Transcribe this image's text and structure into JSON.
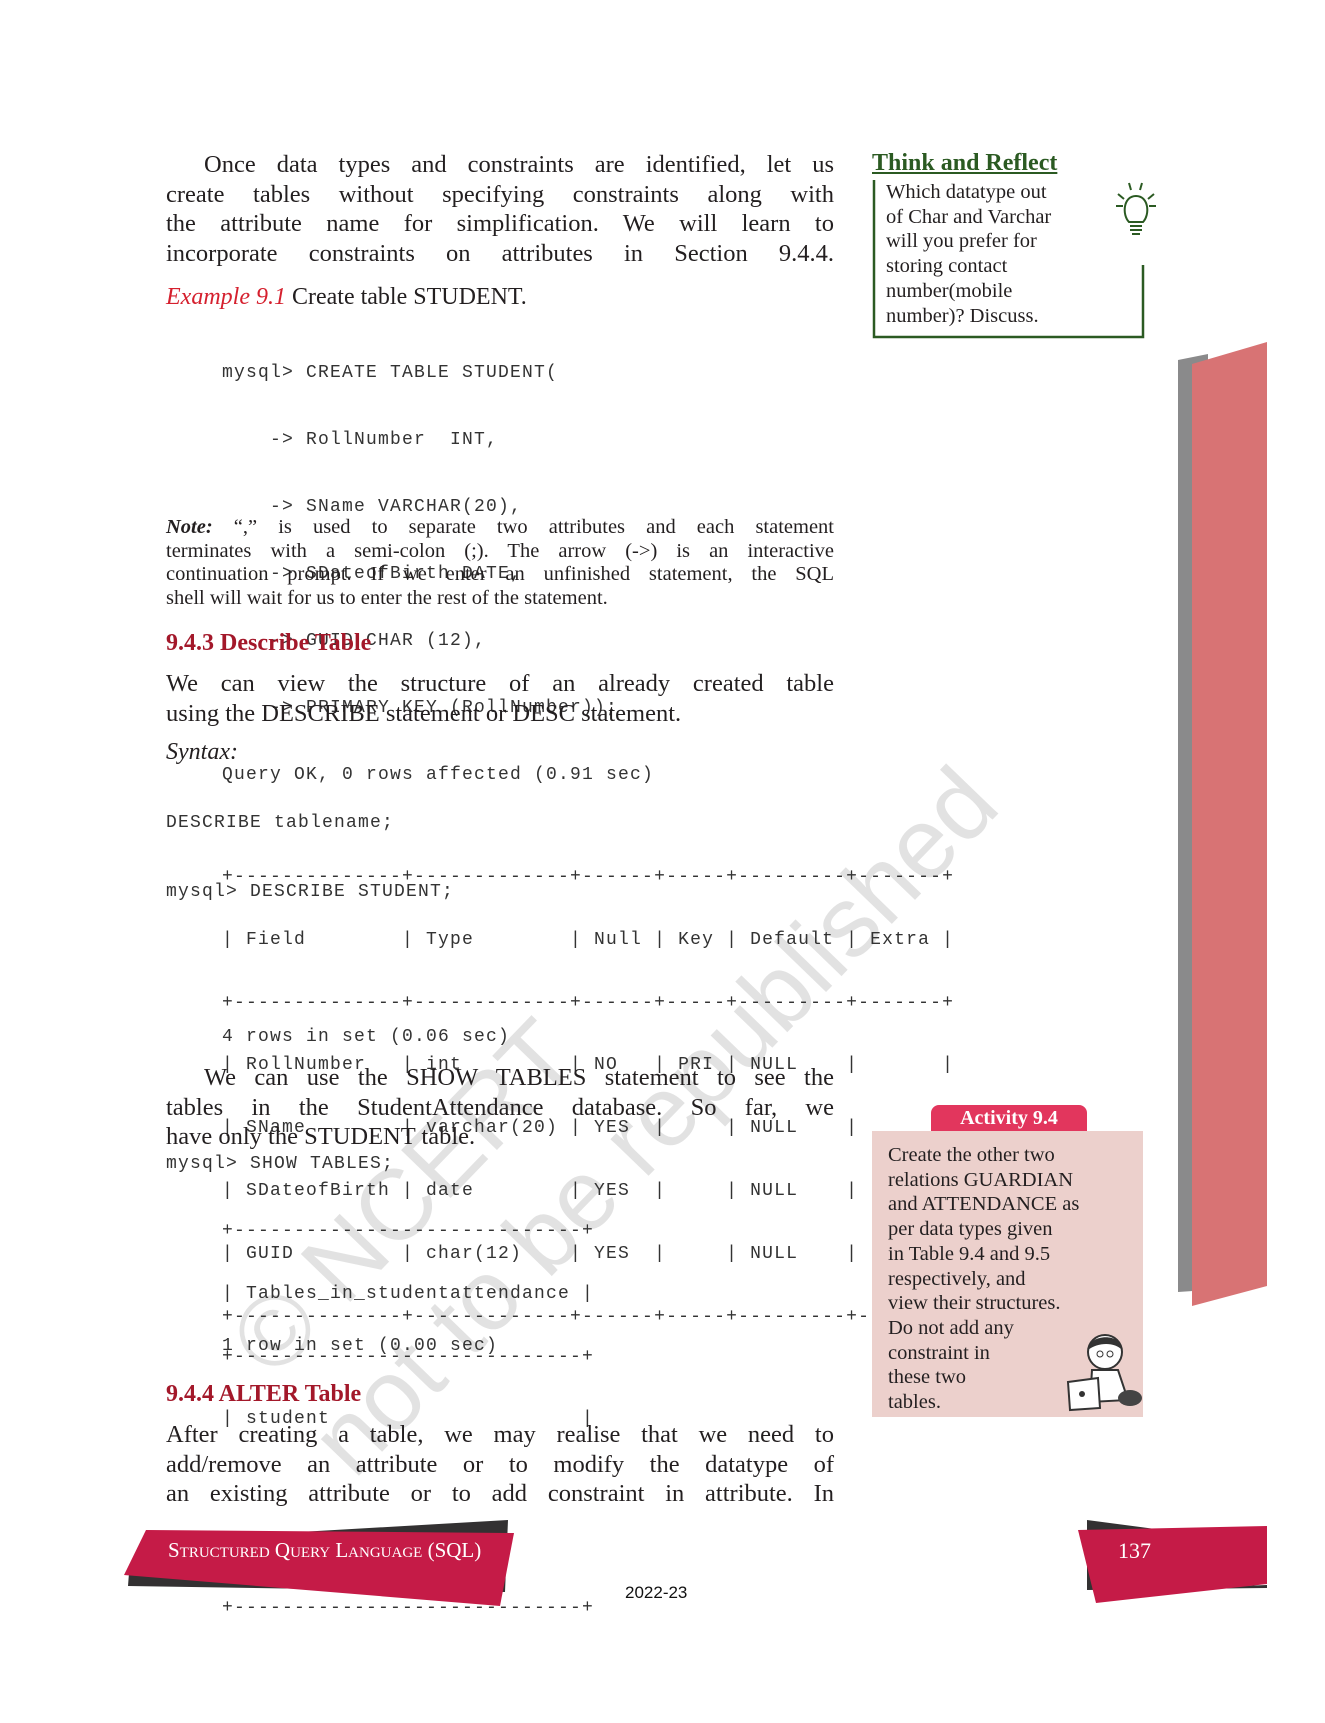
{
  "intro": {
    "lines": [
      "Once data types and constraints are identified, let us",
      "create tables without specifying constraints along with",
      "the attribute name for simplification. We will learn to",
      "incorporate constraints on attributes in Section 9.4.4."
    ]
  },
  "example": {
    "label": "Example 9.1",
    "text": "Create table STUDENT."
  },
  "create_code": [
    "mysql> CREATE TABLE STUDENT(",
    "    -> RollNumber  INT,",
    "    -> SName VARCHAR(20),",
    "    -> SDateofBirth DATE,",
    "    -> GUID CHAR (12),",
    "    -> PRIMARY KEY (RollNumber));",
    "Query OK, 0 rows affected (0.91 sec)"
  ],
  "note": {
    "label": "Note:",
    "lines": [
      "“,” is used to separate two attributes and each statement",
      "terminates with a semi-colon (;). The arrow (->) is an interactive",
      "continuation prompt. If we enter an unfinished statement, the SQL",
      "shell will wait for us to enter the rest of the statement."
    ]
  },
  "section_943": {
    "heading": "9.4.3 Describe Table",
    "lines": [
      "We can view the structure of an already created table",
      "using the DESCRIBE statement or DESC statement."
    ],
    "syntax_label": "Syntax:",
    "syntax": "DESCRIBE tablename;",
    "command": "mysql> DESCRIBE STUDENT;",
    "table": [
      "+--------------+-------------+------+-----+---------+-------+",
      "| Field        | Type        | Null | Key | Default | Extra |",
      "+--------------+-------------+------+-----+---------+-------+",
      "| RollNumber   | int         | NO   | PRI | NULL    |       |",
      "| SName        | varchar(20) | YES  |     | NULL    |       |",
      "| SDateofBirth | date        | YES  |     | NULL    |       |",
      "| GUID         | char(12)    | YES  |     | NULL    |       |",
      "+--------------+-------------+------+-----+---------+-------+"
    ],
    "result": "4 rows in set (0.06 sec)"
  },
  "show_tables": {
    "lines": [
      "We can use the SHOW TABLES statement to see the",
      "tables in the StudentAttendance database. So far, we",
      "have only the STUDENT table."
    ],
    "command": "mysql> SHOW TABLES;",
    "table": [
      "+-----------------------------+",
      "| Tables_in_studentattendance |",
      "+-----------------------------+",
      "| student                     |",
      "",
      "",
      "+-----------------------------+"
    ],
    "result": "1 row in set (0.00 sec)"
  },
  "section_944": {
    "heading": "9.4.4 ALTER Table",
    "lines": [
      "After creating a table, we may realise that we need to",
      "add/remove an attribute or to modify the datatype of",
      "an existing attribute or to add constraint in attribute. In"
    ]
  },
  "think_reflect": {
    "title": "Think and Reflect",
    "icon": "lightbulb-icon",
    "lines": [
      "Which datatype out",
      "of Char and Varchar",
      "will you prefer for",
      "storing contact",
      "number(mobile",
      "number)? Discuss."
    ]
  },
  "activity": {
    "title": "Activity 9.4",
    "lines": [
      "Create the other two",
      "relations GUARDIAN",
      "and ATTENDANCE as",
      "per data types given",
      "in Table 9.4 and 9.5",
      "respectively, and",
      "view their structures.",
      "Do not add any",
      "constraint in",
      "these two",
      "tables."
    ]
  },
  "footer": {
    "chapter": "Structured Query Language (SQL)",
    "page_number": "137",
    "year": "2022-23"
  },
  "watermark": {
    "line1": "© NCERT",
    "line2": "not to be republished"
  },
  "colors": {
    "accent_red": "#c51b47",
    "heading_red": "#a3182a",
    "green": "#2b5a22",
    "activity_bg": "#ecd0cc",
    "example_red": "#d5202e"
  }
}
